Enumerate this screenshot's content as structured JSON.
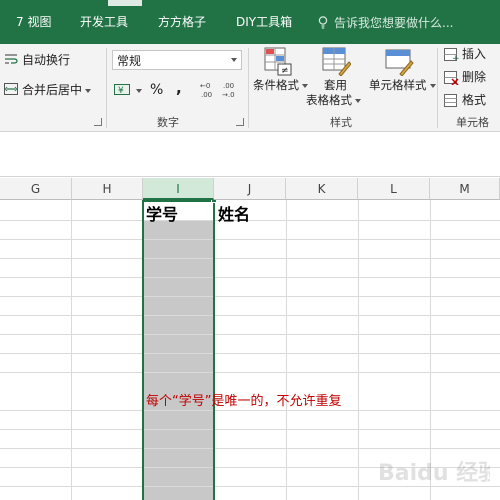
{
  "tabs": [
    {
      "label": "7 视图"
    },
    {
      "label": "开发工具"
    },
    {
      "label": "方方格子"
    },
    {
      "label": "DIY工具箱"
    }
  ],
  "tell_me": {
    "placeholder": "告诉我您想要做什么..."
  },
  "alignment_group": {
    "wrap_text": "自动换行",
    "merge_center": "合并后居中"
  },
  "number_group": {
    "format_value": "常规",
    "currency_symbol": "¥",
    "percent_symbol": "%",
    "comma_symbol": ",",
    "increase_decimal": "+.0 .00",
    "decrease_decimal": ".00 →.0",
    "label": "数字"
  },
  "styles_group": {
    "conditional_format": "条件格式",
    "format_as_table_1": "套用",
    "format_as_table_2": "表格格式",
    "cell_styles": "单元格样式",
    "label": "样式"
  },
  "cells_group": {
    "insert": "插入",
    "delete": "删除",
    "format": "格式",
    "label": "单元格"
  },
  "column_headers": [
    "G",
    "H",
    "I",
    "J",
    "K",
    "L",
    "M"
  ],
  "selected_column": "I",
  "cells": {
    "I1": "学号",
    "J1": "姓名"
  },
  "annotation": "每个“学号”是唯一的，不允许重复",
  "watermark_text": "Baidu 经验",
  "colors": {
    "ribbon_tab_bg": "#217346",
    "selected_column_fill": "#c8c8c8",
    "selection_border": "#217346",
    "annotation_text": "#c00000"
  }
}
